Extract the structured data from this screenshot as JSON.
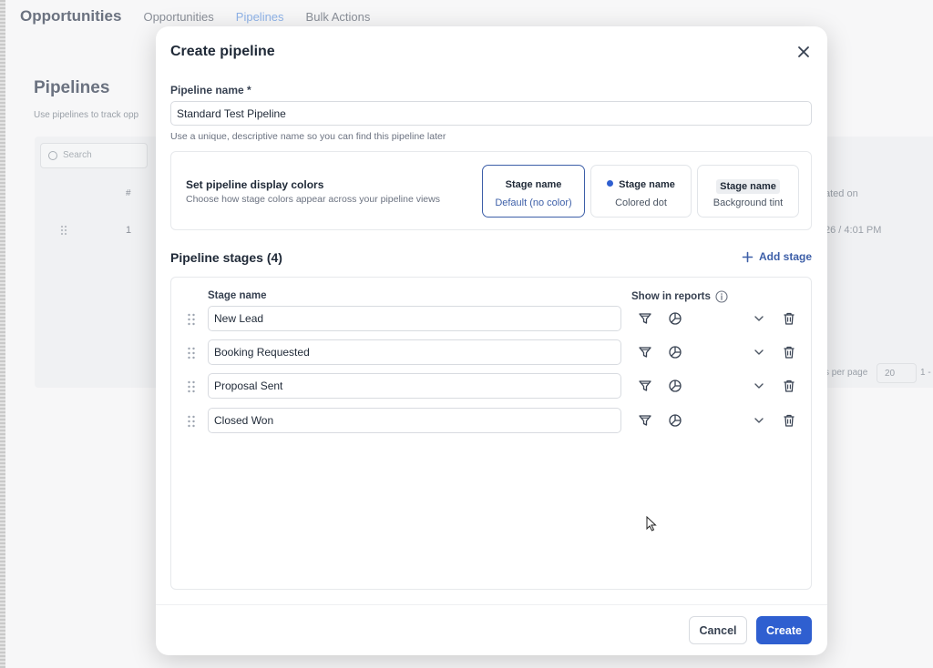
{
  "background": {
    "app_title": "Opportunities",
    "nav": [
      "Opportunities",
      "Pipelines",
      "Bulk Actions"
    ],
    "active_nav": "Pipelines",
    "page_title": "Pipelines",
    "page_subtitle": "Use pipelines to track opp",
    "search_placeholder": "Search",
    "col_hash": "#",
    "row_number": "1",
    "col_created": "ated on",
    "created_value": "26 / 4:01 PM",
    "per_page_label": "s per page",
    "per_page_value": "20",
    "range_text": "1 -"
  },
  "modal": {
    "title": "Create pipeline",
    "name_label": "Pipeline name *",
    "name_value": "Standard Test Pipeline",
    "helper_text": "Use a unique, descriptive name so you can find this pipeline later",
    "colors": {
      "title": "Set pipeline display colors",
      "subtitle": "Choose how stage colors appear across your pipeline views",
      "options": [
        {
          "top": "Stage name",
          "bottom": "Default (no color)",
          "selected": true
        },
        {
          "top": "Stage name",
          "bottom": "Colored dot",
          "selected": false
        },
        {
          "top": "Stage name",
          "bottom": "Background tint",
          "selected": false
        }
      ]
    },
    "stages_title": "Pipeline stages (4)",
    "add_stage_label": "Add stage",
    "col_stage_name": "Stage name",
    "col_show_reports": "Show in reports",
    "stages": [
      "New Lead",
      "Booking Requested",
      "Proposal Sent",
      "Closed Won"
    ],
    "cancel_label": "Cancel",
    "create_label": "Create"
  },
  "colors": {
    "accent": "#2f5fd0",
    "selected_border": "#3d5fa8"
  }
}
